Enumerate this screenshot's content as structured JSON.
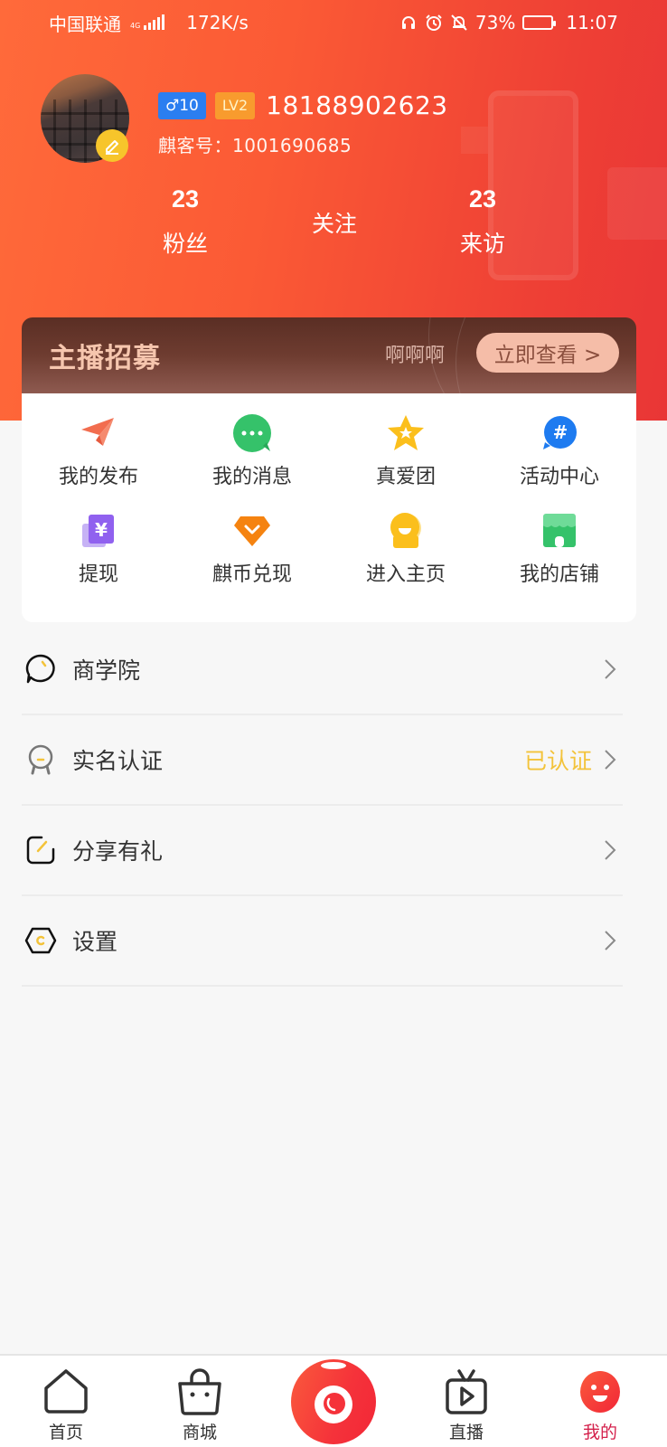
{
  "status_bar": {
    "carrier": "中国联通",
    "network_type": "4G",
    "speed": "172K/s",
    "battery": "73%",
    "battery_level": 0.73,
    "time": "11:07",
    "icons": [
      "headphones-icon",
      "alarm-icon",
      "bell-muted-icon"
    ]
  },
  "profile": {
    "avatar": "keyboard-photo",
    "gender_badge": "♂10",
    "level_badge": "LV2",
    "phone": "18188902623",
    "uid_label": "麒客号：",
    "uid": "1001690685"
  },
  "stats": {
    "fans": {
      "count": "23",
      "label": "粉丝"
    },
    "following": {
      "label": "关注"
    },
    "visitors": {
      "count": "23",
      "label": "来访"
    }
  },
  "recruit_banner": {
    "title": "主播招募",
    "subtitle": "啊啊啊",
    "button_label": "立即查看 >"
  },
  "grid": [
    {
      "label": "我的发布",
      "icon": "paper-plane-icon",
      "color": "#f26d4f"
    },
    {
      "label": "我的消息",
      "icon": "chat-bubble-icon",
      "color": "#35c26a"
    },
    {
      "label": "真爱团",
      "icon": "star-icon",
      "color": "#fbbf1c"
    },
    {
      "label": "活动中心",
      "icon": "hashtag-icon",
      "color": "#1e7bf0"
    },
    {
      "label": "提现",
      "icon": "yuan-wallet-icon",
      "color": "#9061ef"
    },
    {
      "label": "麒币兑现",
      "icon": "diamond-icon",
      "color": "#f58310"
    },
    {
      "label": "进入主页",
      "icon": "home-avatar-icon",
      "color": "#fbbf1c"
    },
    {
      "label": "我的店铺",
      "icon": "store-icon",
      "color": "#35c26a"
    }
  ],
  "menu": [
    {
      "label": "商学院",
      "icon": "chat-circle-icon",
      "value": ""
    },
    {
      "label": "实名认证",
      "icon": "badge-icon",
      "value": "已认证"
    },
    {
      "label": "分享有礼",
      "icon": "edit-square-icon",
      "value": ""
    },
    {
      "label": "设置",
      "icon": "hexagon-gear-icon",
      "value": ""
    }
  ],
  "tabbar": {
    "tabs": [
      {
        "label": "首页",
        "icon": "home-icon",
        "active": false
      },
      {
        "label": "商城",
        "icon": "shopping-bag-icon",
        "active": false
      },
      {
        "label": "",
        "icon": "live-camera-icon",
        "active": false
      },
      {
        "label": "直播",
        "icon": "tv-play-icon",
        "active": false
      },
      {
        "label": "我的",
        "icon": "smiley-face-icon",
        "active": true
      }
    ],
    "active_color": "#d4214c"
  }
}
